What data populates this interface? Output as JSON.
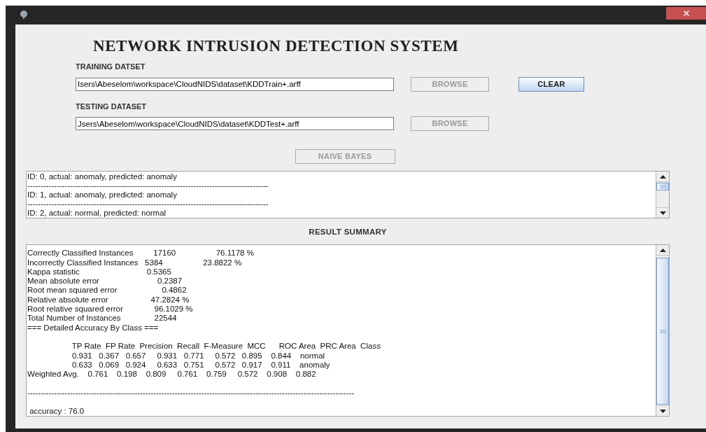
{
  "title": "NETWORK INTRUSION DETECTION SYSTEM",
  "training": {
    "label": "TRAINING DATSET",
    "value": "Isers\\Abeselom\\workspace\\CloudNIDS\\dataset\\KDDTrain+.arff",
    "browse": {
      "label": "BROWSE",
      "disabled": true
    },
    "clear": {
      "label": "CLEAR",
      "disabled": false
    }
  },
  "testing": {
    "label": "TESTING DATASET",
    "value": "Jsers\\Abeselom\\workspace\\CloudNIDS\\dataset\\KDDTest+.arff",
    "browse": {
      "label": "BROWSE",
      "disabled": true
    }
  },
  "classify_button": {
    "label": "NAIVE BAYES",
    "disabled": true
  },
  "predictions": [
    "ID: 0, actual: anomaly, predicted: anomaly",
    "------------------------------------------------------------------------------------------",
    "ID: 1, actual: anomaly, predicted: anomaly",
    "------------------------------------------------------------------------------------------",
    "ID: 2, actual: normal, predicted: normal"
  ],
  "summary_heading": "RESULT SUMMARY",
  "summary_blocks": [
    [
      "Correctly Classified Instances         17160                  76.1178 %",
      "Incorrectly Classified Instances   5384                  23.8822 %",
      "Kappa statistic                              0.5365",
      "Mean absolute error                          0.2387",
      "Root mean squared error                    0.4862",
      "Relative absolute error                   47.2824 %",
      "Root relative squared error              96.1029 %",
      "Total Number of Instances               22544",
      "=== Detailed Accuracy By Class ==="
    ],
    [
      "                    TP Rate  FP Rate  Precision  Recall  F-Measure  MCC      ROC Area  PRC Area  Class",
      "                    0.931   0.367   0.657     0.931   0.771     0.572   0.895    0.844    normal",
      "                    0.633   0.069   0.924     0.633   0.751     0.572   0.917    0.911    anomaly",
      "Weighted Avg.    0.761    0.198    0.809     0.761    0.759     0.572    0.908    0.882"
    ],
    [
      "--------------------------------------------------------------------------------------------------------------------------"
    ],
    [
      " accuracy : 76.0"
    ]
  ]
}
